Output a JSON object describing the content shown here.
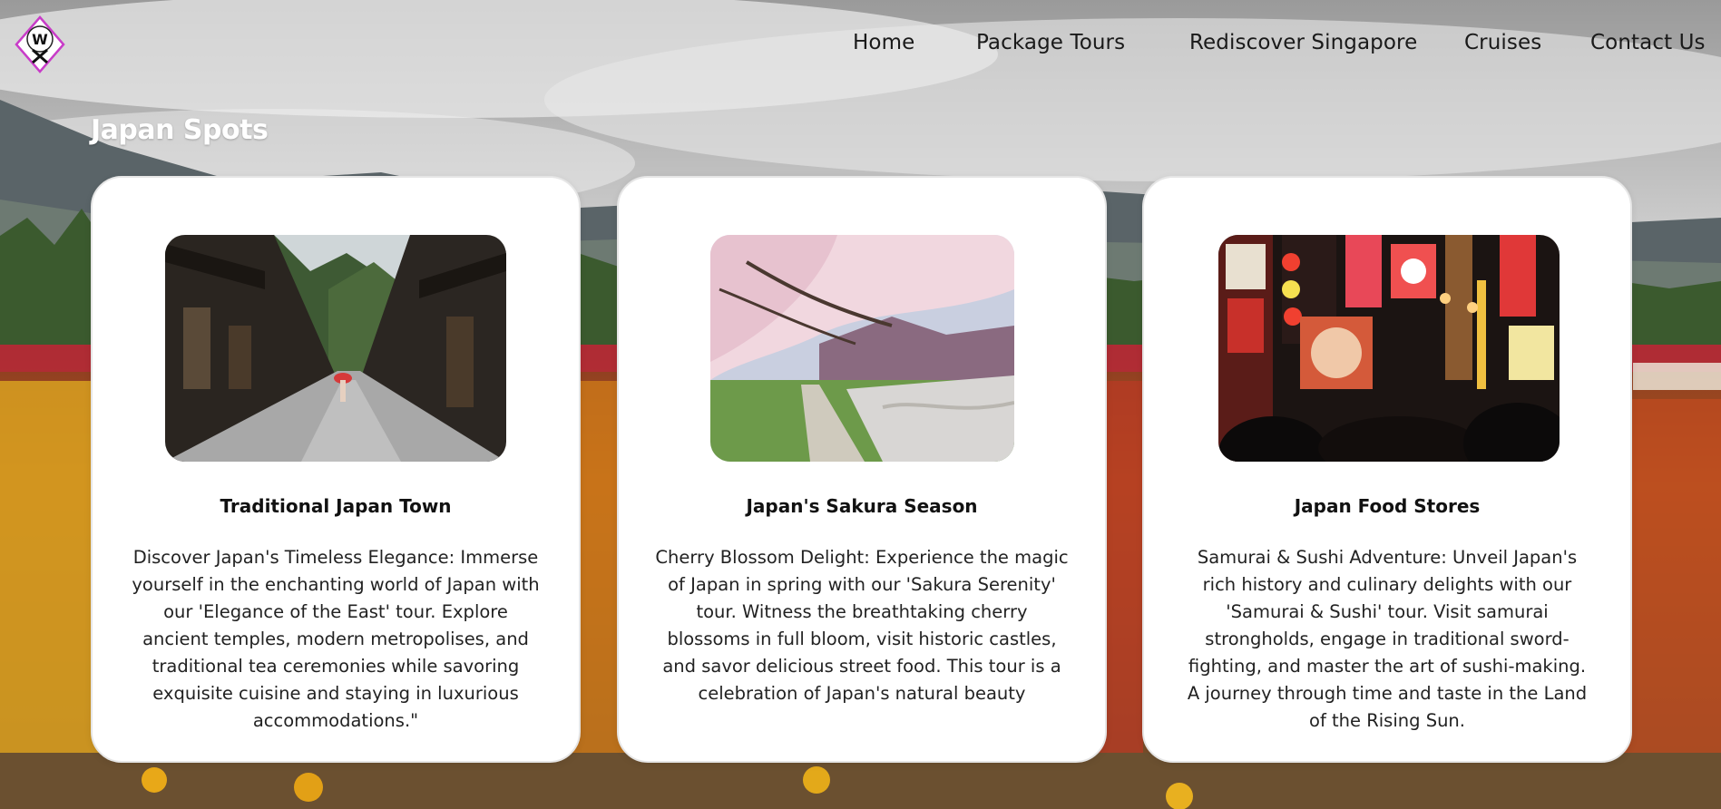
{
  "nav": {
    "logo_letters": "W X",
    "links": [
      {
        "label": "Home"
      },
      {
        "label": "Package Tours"
      },
      {
        "label": "Rediscover Singapore"
      },
      {
        "label": "Cruises"
      },
      {
        "label": "Contact Us"
      }
    ]
  },
  "section": {
    "title": "Japan Spots"
  },
  "cards": [
    {
      "image_icon": "traditional-town-photo",
      "title": "Traditional Japan Town",
      "description": "Discover Japan's Timeless Elegance: Immerse yourself in the enchanting world of Japan with our 'Elegance of the East' tour. Explore ancient temples, modern metropolises, and traditional tea ceremonies while savoring exquisite cuisine and staying in luxurious accommodations.\""
    },
    {
      "image_icon": "sakura-season-photo",
      "title": "Japan's Sakura Season",
      "description": "Cherry Blossom Delight: Experience the magic of Japan in spring with our 'Sakura Serenity' tour. Witness the breathtaking cherry blossoms in full bloom, visit historic castles, and savor delicious street food. This tour is a celebration of Japan's natural beauty"
    },
    {
      "image_icon": "food-stores-photo",
      "title": "Japan Food Stores",
      "description": "Samurai & Sushi Adventure: Unveil Japan's rich history and culinary delights with our 'Samurai & Sushi' tour. Visit samurai strongholds, engage in traditional sword-fighting, and master the art of sushi-making. A journey through time and taste in the Land of the Rising Sun."
    }
  ],
  "colors": {
    "card_bg": "#ffffff",
    "title_white": "#ffffff",
    "nav_text": "#1a1a1a",
    "logo_accent": "#c83cc8"
  }
}
